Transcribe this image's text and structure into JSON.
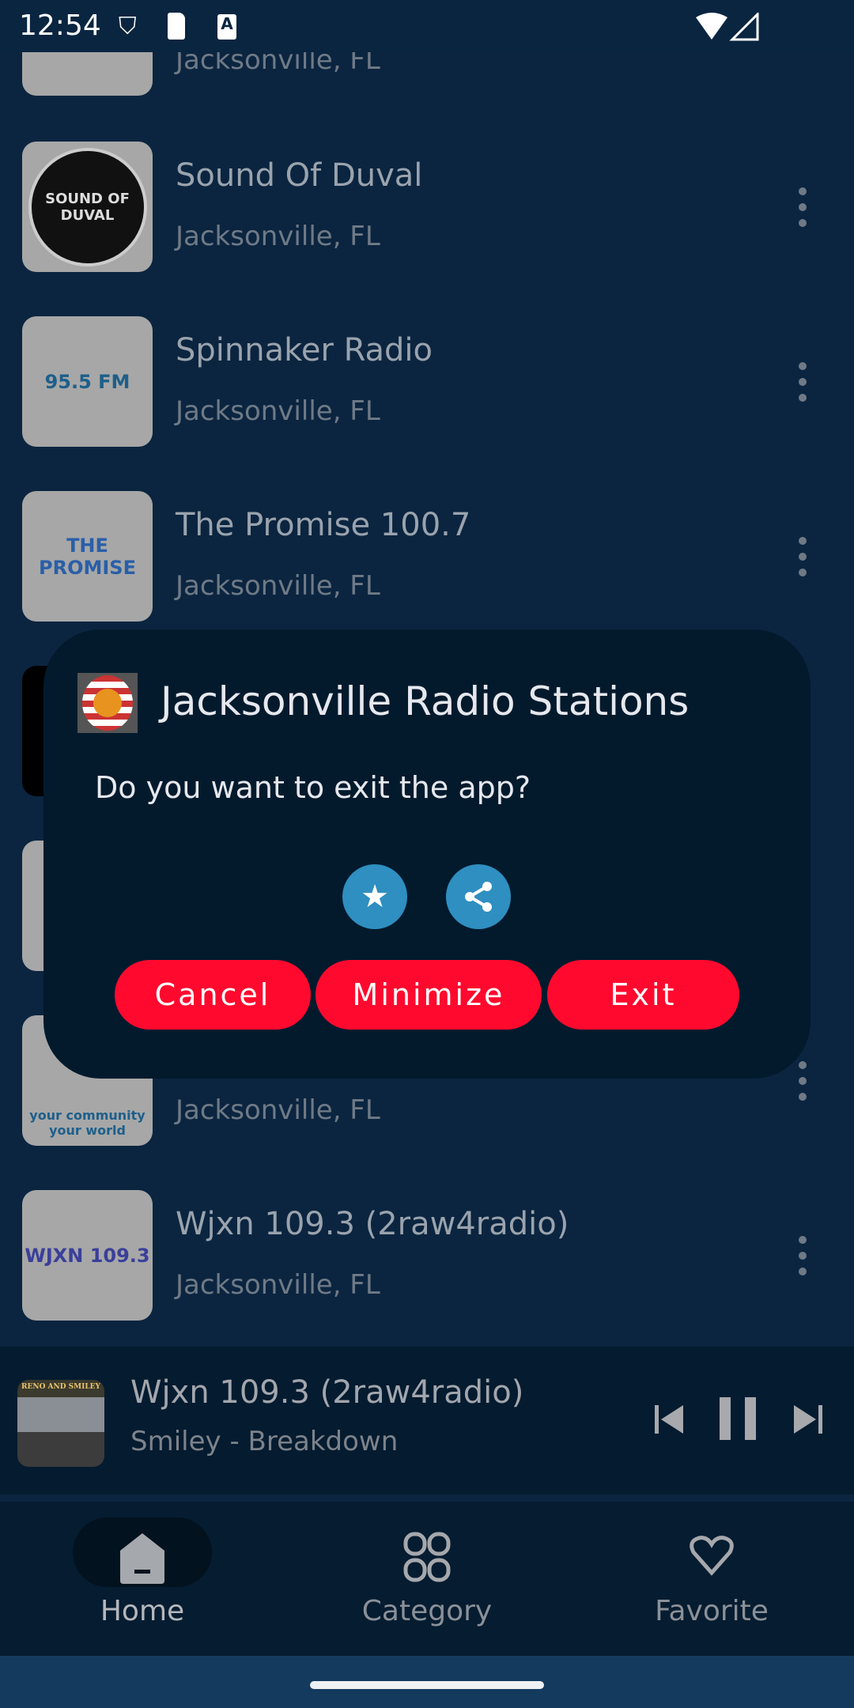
{
  "status_bar": {
    "time": "12:54",
    "icons": [
      "shield-icon",
      "sd-card-icon",
      "font-a-icon",
      "wifi-icon",
      "signal-icon"
    ]
  },
  "stations": [
    {
      "title": "",
      "subtitle": "Jacksonville, FL",
      "logo_text": ""
    },
    {
      "title": "Sound Of Duval",
      "subtitle": "Jacksonville, FL",
      "logo_text": "SOUND OF DUVAL"
    },
    {
      "title": "Spinnaker Radio",
      "subtitle": "Jacksonville, FL",
      "logo_text": "95.5 FM"
    },
    {
      "title": "The Promise 100.7",
      "subtitle": "Jacksonville, FL",
      "logo_text": "THE PROMISE"
    },
    {
      "title": "",
      "subtitle": "",
      "logo_text": ""
    },
    {
      "title": "",
      "subtitle": "",
      "logo_text": ""
    },
    {
      "title": "",
      "subtitle": "Jacksonville, FL",
      "logo_text": "your community your world"
    },
    {
      "title": "Wjxn 109.3 (2raw4radio)",
      "subtitle": "Jacksonville, FL",
      "logo_text": "WJXN 109.3"
    }
  ],
  "dialog": {
    "title": "Jacksonville Radio Stations",
    "message": "Do you want to exit the app?",
    "cancel": "Cancel",
    "minimize": "Minimize",
    "exit": "Exit",
    "button_color": "#ff0a2e",
    "icon_button_color": "#2f8fc0"
  },
  "player": {
    "title": "Wjxn 109.3 (2raw4radio)",
    "subtitle": "Smiley - Breakdown",
    "artwork_text": "RENO AND SMILEY"
  },
  "nav": {
    "home": "Home",
    "category": "Category",
    "favorite": "Favorite",
    "active": "Home"
  }
}
